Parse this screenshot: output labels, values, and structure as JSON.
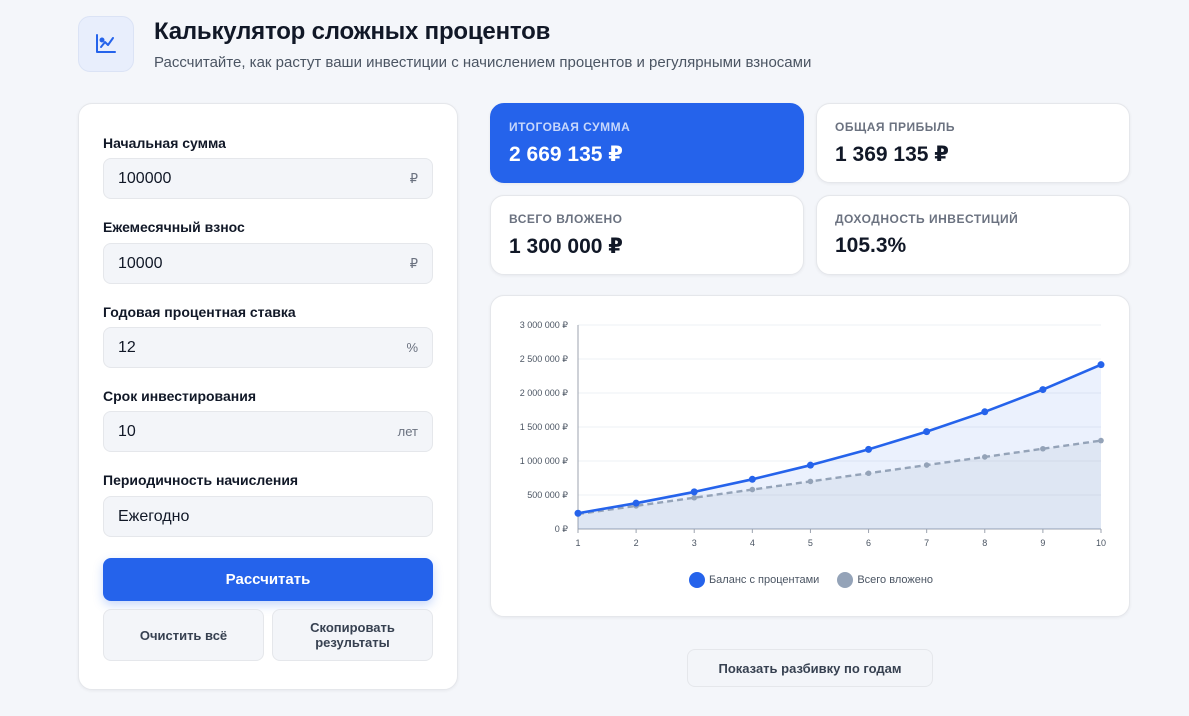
{
  "header": {
    "title": "Калькулятор сложных процентов",
    "subtitle": "Рассчитайте, как растут ваши инвестиции с начислением процентов и регулярными взносами",
    "logo_icon": "chart-growth-icon"
  },
  "form": {
    "fields": [
      {
        "label": "Начальная сумма",
        "value": "100000",
        "suffix": "₽"
      },
      {
        "label": "Ежемесячный взнос",
        "value": "10000",
        "suffix": "₽"
      },
      {
        "label": "Годовая процентная ставка",
        "value": "12",
        "suffix": "%"
      },
      {
        "label": "Срок инвестирования",
        "value": "10",
        "suffix": "лет"
      },
      {
        "label": "Периодичность начисления",
        "value": "Ежегодно",
        "suffix": ""
      }
    ],
    "calculate_label": "Рассчитать",
    "clear_label": "Очистить всё",
    "copy_label": "Скопировать результаты"
  },
  "stats": [
    {
      "label": "Итоговая сумма",
      "value": "2 669 135 ₽"
    },
    {
      "label": "Общая прибыль",
      "value": "1 369 135 ₽"
    },
    {
      "label": "Всего вложено",
      "value": "1 300 000 ₽"
    },
    {
      "label": "Доходность инвестиций",
      "value": "105.3%"
    }
  ],
  "breakdown_label": "Показать разбивку по годам",
  "colors": {
    "accent": "#2563eb",
    "invested": "#94a3b8",
    "background": "#f4f6fa"
  },
  "chart_data": {
    "type": "line",
    "x": [
      1,
      2,
      3,
      4,
      5,
      6,
      7,
      8,
      9,
      10
    ],
    "series": [
      {
        "name": "Баланс с процентами",
        "values": [
          232000,
          379840,
          545421,
          730871,
          938575,
          1171204,
          1431749,
          1723559,
          2050386,
          2416433
        ],
        "style": "solid",
        "color": "#2563eb",
        "fill": true
      },
      {
        "name": "Всего вложено",
        "values": [
          220000,
          340000,
          460000,
          580000,
          700000,
          820000,
          940000,
          1060000,
          1180000,
          1300000
        ],
        "style": "dashed",
        "color": "#94a3b8",
        "fill": true
      }
    ],
    "y_ticks": [
      "0 ₽",
      "500 000 ₽",
      "1 000 000 ₽",
      "1 500 000 ₽",
      "2 000 000 ₽",
      "2 500 000 ₽",
      "3 000 000 ₽"
    ],
    "y_tick_values": [
      0,
      500000,
      1000000,
      1500000,
      2000000,
      2500000,
      3000000
    ],
    "ylim": [
      0,
      3000000
    ],
    "grid": true,
    "legend": "bottom-center"
  }
}
